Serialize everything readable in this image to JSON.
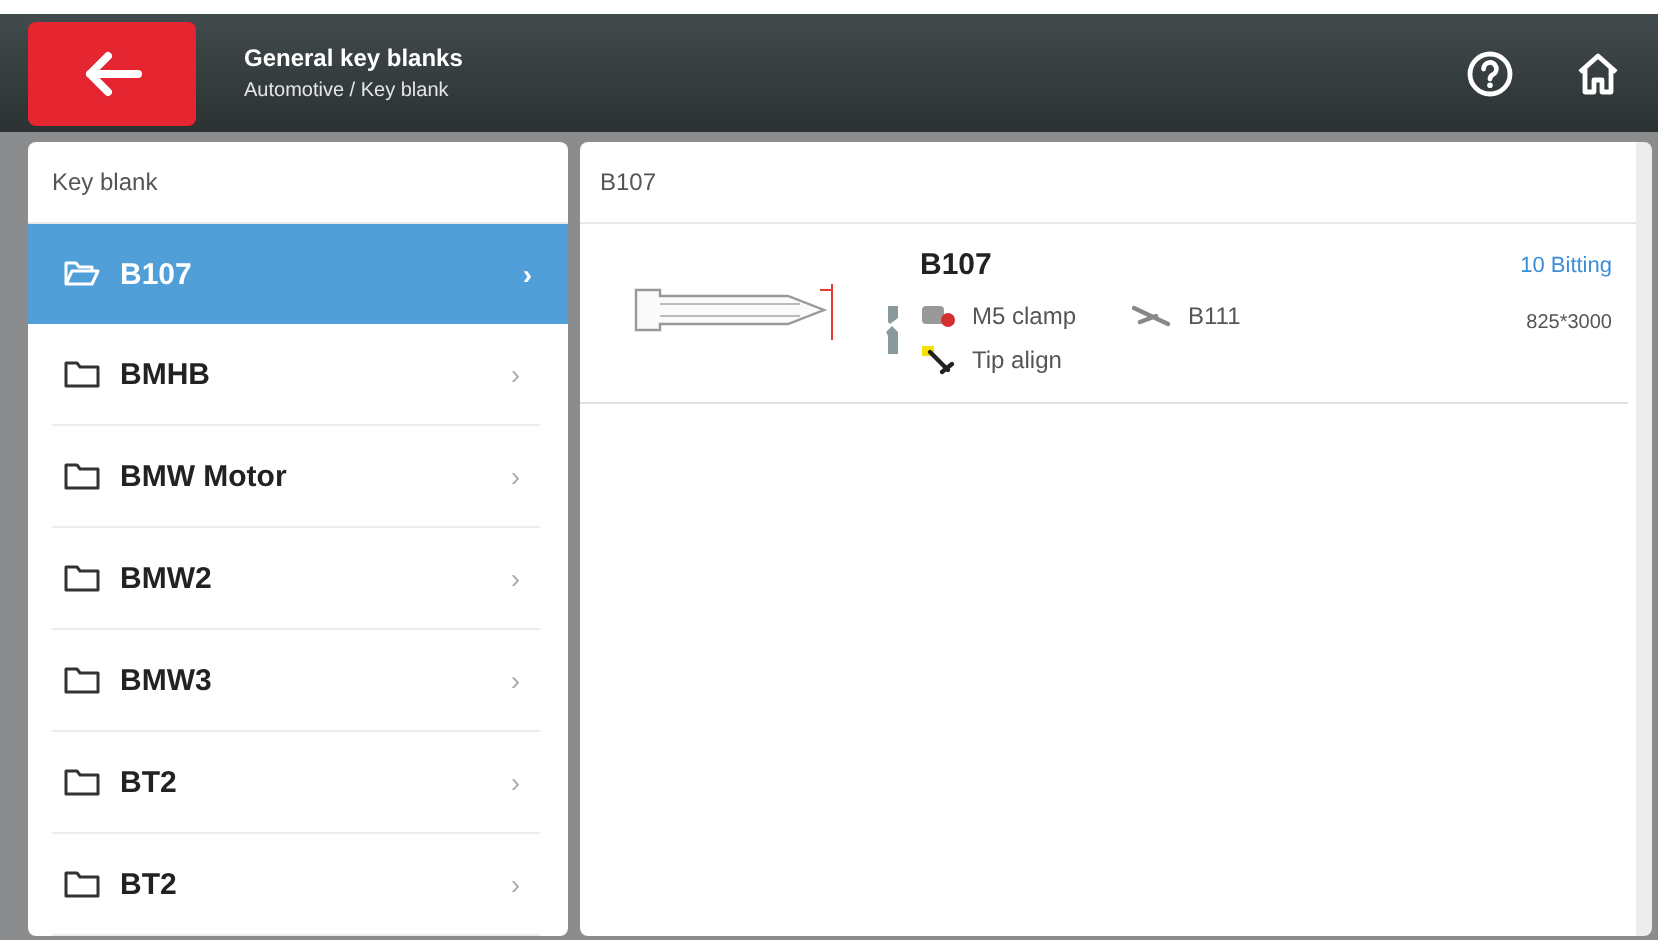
{
  "header": {
    "title": "General key blanks",
    "breadcrumb": "Automotive / Key blank"
  },
  "sidebar": {
    "heading": "Key blank",
    "items": [
      {
        "label": "B107",
        "selected": true,
        "chevron": "›"
      },
      {
        "label": "BMHB",
        "selected": false,
        "chevron": "›"
      },
      {
        "label": "BMW Motor",
        "selected": false,
        "chevron": "›"
      },
      {
        "label": "BMW2",
        "selected": false,
        "chevron": "›"
      },
      {
        "label": "BMW3",
        "selected": false,
        "chevron": "›"
      },
      {
        "label": "BT2",
        "selected": false,
        "chevron": "›"
      },
      {
        "label": "BT2",
        "selected": false,
        "chevron": "›"
      }
    ]
  },
  "content": {
    "heading": "B107",
    "keys": [
      {
        "name": "B107",
        "clamp": "M5 clamp",
        "cutter": "B111",
        "align": "Tip align",
        "bitting": "10 Bitting",
        "size": "825*3000"
      }
    ]
  }
}
